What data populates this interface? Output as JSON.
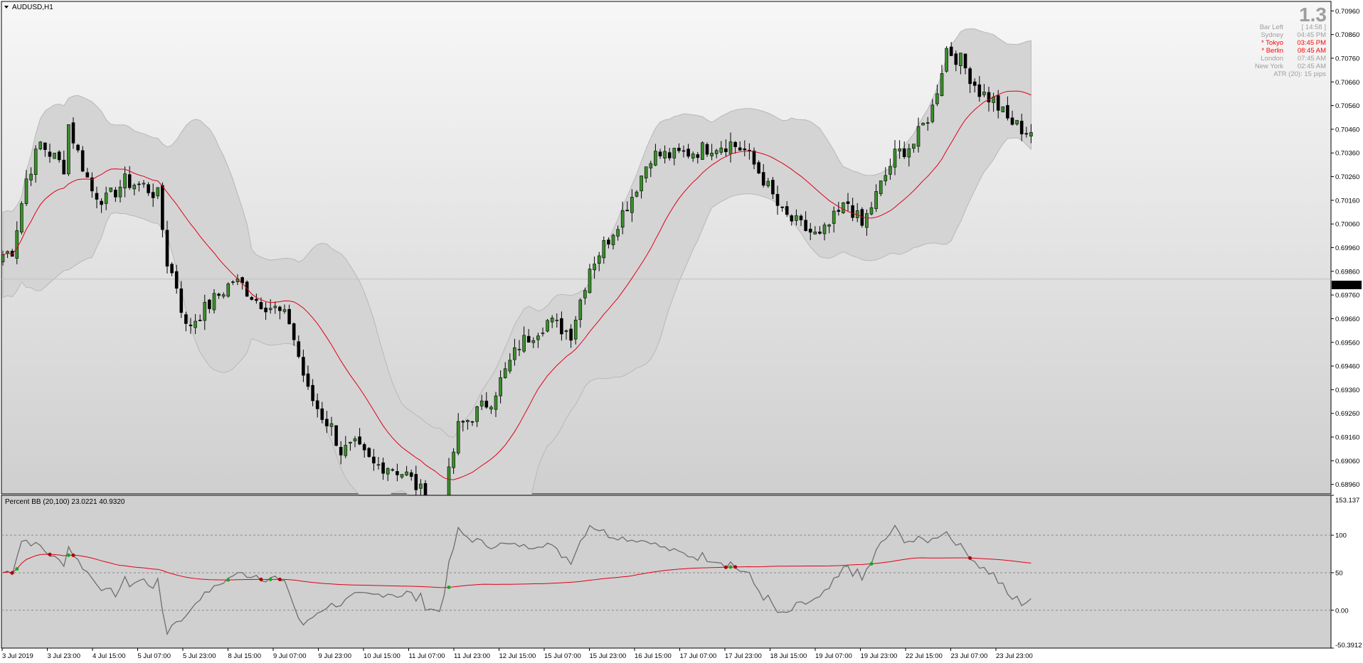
{
  "window": {
    "symbol_label": "AUDUSD,H1"
  },
  "info_panel": {
    "big_value": "1.3",
    "rows": [
      {
        "label": "Bar Left",
        "value": "[ 14:58 ]",
        "color": "#9e9e9e"
      },
      {
        "label": "Sydney",
        "value": "04:45 PM",
        "color": "#9e9e9e"
      },
      {
        "label": "* Tokyo",
        "value": "03:45 PM",
        "color": "#ff0000"
      },
      {
        "label": "* Berlin",
        "value": "08:45 AM",
        "color": "#ff0000"
      },
      {
        "label": "London",
        "value": "07:45 AM",
        "color": "#9e9e9e"
      },
      {
        "label": "New York",
        "value": "02:45 AM",
        "color": "#9e9e9e"
      }
    ],
    "atr_text": "ATR (20): 15 pips"
  },
  "indicator": {
    "title": "Percent BB (20,100) 23.0221 40.9320",
    "axis_labels": [
      "153.137",
      "100",
      "50",
      "0.00",
      "-50.3912"
    ]
  },
  "current_price_label": "0.69827",
  "colors": {
    "bull_body": "#3a8f2a",
    "bear_body": "#000000",
    "band_fill": "#d4d4d4",
    "band_line": "#b8b8b8",
    "middle_line": "#e0001a",
    "pb_line": "#6e6e6e",
    "price_line": "#c0c0c0",
    "up_marker": "#1ea51e",
    "down_marker": "#b00000"
  },
  "chart_data": [
    {
      "type": "candlestick",
      "symbol": "AUDUSD",
      "timeframe": "H1",
      "y_ticks": [
        "0.70960",
        "0.70860",
        "0.70760",
        "0.70660",
        "0.70560",
        "0.70460",
        "0.70360",
        "0.70260",
        "0.70160",
        "0.70060",
        "0.69960",
        "0.69860",
        "0.69760",
        "0.69660",
        "0.69560",
        "0.69460",
        "0.69360",
        "0.69260",
        "0.69160",
        "0.69060",
        "0.68960"
      ],
      "ylim": [
        0.6892,
        0.71
      ],
      "x_ticks": [
        "3 Jul 2019",
        "3 Jul 23:00",
        "4 Jul 15:00",
        "5 Jul 07:00",
        "5 Jul 23:00",
        "8 Jul 15:00",
        "9 Jul 07:00",
        "9 Jul 23:00",
        "10 Jul 15:00",
        "11 Jul 07:00",
        "11 Jul 23:00",
        "12 Jul 15:00",
        "15 Jul 07:00",
        "15 Jul 23:00",
        "16 Jul 15:00",
        "17 Jul 07:00",
        "17 Jul 23:00",
        "18 Jul 15:00",
        "19 Jul 07:00",
        "19 Jul 23:00",
        "22 Jul 15:00",
        "23 Jul 07:00",
        "23 Jul 23:00"
      ],
      "bar_count": 220,
      "anchors": [
        [
          0,
          0.6993
        ],
        [
          2,
          0.6995
        ],
        [
          5,
          0.7025
        ],
        [
          8,
          0.704
        ],
        [
          13,
          0.703
        ],
        [
          14,
          0.7048
        ],
        [
          16,
          0.7036
        ],
        [
          19,
          0.702
        ],
        [
          22,
          0.7016
        ],
        [
          26,
          0.7024
        ],
        [
          30,
          0.7022
        ],
        [
          33,
          0.7018
        ],
        [
          35,
          0.699
        ],
        [
          37,
          0.698
        ],
        [
          39,
          0.6962
        ],
        [
          44,
          0.6972
        ],
        [
          49,
          0.6982
        ],
        [
          51,
          0.698
        ],
        [
          54,
          0.6974
        ],
        [
          58,
          0.697
        ],
        [
          61,
          0.6965
        ],
        [
          65,
          0.6935
        ],
        [
          68,
          0.6925
        ],
        [
          70,
          0.692
        ],
        [
          72,
          0.691
        ],
        [
          75,
          0.6912
        ],
        [
          79,
          0.6904
        ],
        [
          82,
          0.6904
        ],
        [
          86,
          0.69
        ],
        [
          89,
          0.6893
        ],
        [
          93,
          0.688
        ],
        [
          97,
          0.692
        ],
        [
          100,
          0.6925
        ],
        [
          104,
          0.6932
        ],
        [
          110,
          0.6955
        ],
        [
          116,
          0.6965
        ],
        [
          121,
          0.696
        ],
        [
          125,
          0.6988
        ],
        [
          129,
          0.7
        ],
        [
          134,
          0.7018
        ],
        [
          138,
          0.7035
        ],
        [
          143,
          0.7035
        ],
        [
          148,
          0.7037
        ],
        [
          151,
          0.7039
        ],
        [
          155,
          0.704
        ],
        [
          158,
          0.7037
        ],
        [
          162,
          0.7025
        ],
        [
          166,
          0.701
        ],
        [
          170,
          0.7005
        ],
        [
          174,
          0.7
        ],
        [
          177,
          0.7008
        ],
        [
          180,
          0.7015
        ],
        [
          183,
          0.7005
        ],
        [
          186,
          0.7018
        ],
        [
          190,
          0.7035
        ],
        [
          194,
          0.704
        ],
        [
          198,
          0.7055
        ],
        [
          201,
          0.708
        ],
        [
          204,
          0.7075
        ],
        [
          208,
          0.7062
        ],
        [
          211,
          0.7058
        ],
        [
          214,
          0.705
        ],
        [
          218,
          0.7045
        ]
      ],
      "note_scale": {
        "first_anchor_px": 10
      }
    },
    {
      "type": "line",
      "name": "Percent BB (20,100)",
      "ylim": [
        -50.3912,
        153.137
      ],
      "y_ticks": [
        153.137,
        100,
        50,
        0.0,
        -50.3912
      ],
      "series": [
        {
          "name": "23.0221",
          "role": "percent_b"
        },
        {
          "name": "40.9320",
          "role": "signal"
        }
      ]
    }
  ]
}
